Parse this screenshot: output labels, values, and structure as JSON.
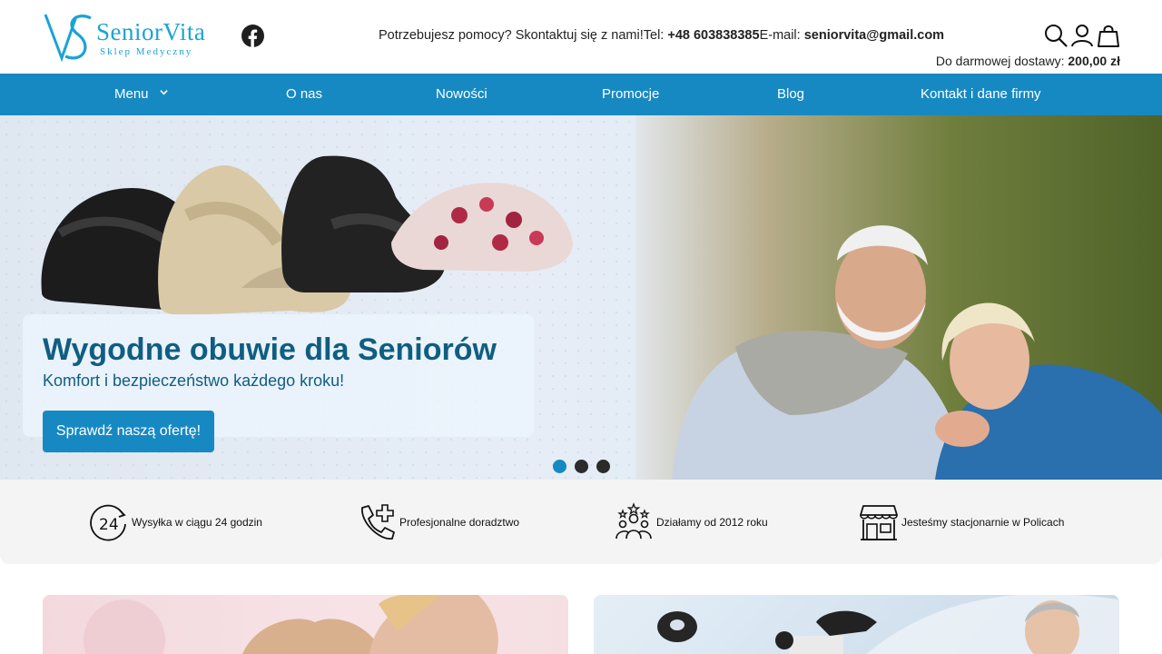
{
  "brand": {
    "name": "SeniorVita",
    "tagline": "Sklep Medyczny",
    "color": "#1aa3d6"
  },
  "header": {
    "help_text": "Potrzebujesz pomocy? Skontaktuj się z nami!",
    "tel_label": "Tel:",
    "tel_value": "+48 603838385",
    "email_label": "E-mail:",
    "email_value": "seniorvita@gmail.com",
    "free_shipping_label": "Do darmowej dostawy:",
    "free_shipping_value": "200,00 zł",
    "icons": [
      "facebook-icon",
      "search-icon",
      "user-icon",
      "cart-bag-icon"
    ]
  },
  "nav": {
    "color": "#1789c2",
    "items": [
      {
        "label": "Menu"
      },
      {
        "label": "O nas"
      },
      {
        "label": "Nowości"
      },
      {
        "label": "Promocje"
      },
      {
        "label": "Blog"
      },
      {
        "label": "Kontakt i dane firmy"
      }
    ]
  },
  "hero": {
    "title": "Wygodne obuwie dla Seniorów",
    "subtitle": "Komfort i bezpieczeństwo każdego kroku!",
    "cta": "Sprawdź naszą ofertę!",
    "slides_total": 3,
    "active_slide": 1
  },
  "features": [
    {
      "icon": "clock-24-icon",
      "label": "Wysyłka w ciągu 24 godzin"
    },
    {
      "icon": "phone-plus-icon",
      "label": "Profesjonalne doradztwo"
    },
    {
      "icon": "team-stars-icon",
      "label": "Działamy od 2012 roku"
    },
    {
      "icon": "storefront-icon",
      "label": "Jesteśmy stacjonarnie w Policach"
    }
  ]
}
